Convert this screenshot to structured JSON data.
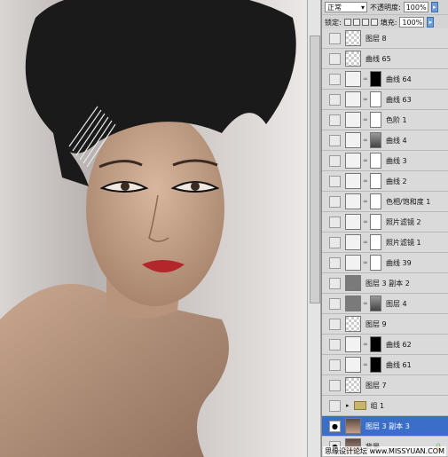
{
  "panel": {
    "blend_mode": "正常",
    "opacity_label": "不透明度:",
    "opacity_value": "100%",
    "lock_label": "锁定:",
    "fill_label": "填充:",
    "fill_value": "100%"
  },
  "layers": [
    {
      "name": "图层 8",
      "thumb": "trans",
      "mask": "none"
    },
    {
      "name": "曲线 65",
      "thumb": "trans",
      "mask": "none"
    },
    {
      "name": "曲线 64",
      "thumb": "adj",
      "mask": "black"
    },
    {
      "name": "曲线 63",
      "thumb": "adj",
      "mask": "white"
    },
    {
      "name": "色阶 1",
      "thumb": "adj",
      "mask": "white"
    },
    {
      "name": "曲线 4",
      "thumb": "adj",
      "mask": "gray"
    },
    {
      "name": "曲线 3",
      "thumb": "adj",
      "mask": "white"
    },
    {
      "name": "曲线 2",
      "thumb": "adj",
      "mask": "white"
    },
    {
      "name": "色相/饱和度 1",
      "thumb": "adj",
      "mask": "white"
    },
    {
      "name": "照片滤镜 2",
      "thumb": "adj",
      "mask": "white"
    },
    {
      "name": "照片滤镜 1",
      "thumb": "adj",
      "mask": "white"
    },
    {
      "name": "曲线 39",
      "thumb": "adj",
      "mask": "white"
    },
    {
      "name": "图层 3 副本 2",
      "thumb": "dark",
      "mask": "none"
    },
    {
      "name": "图层 4",
      "thumb": "dark",
      "mask": "gray"
    },
    {
      "name": "图层 9",
      "thumb": "trans",
      "mask": "none"
    },
    {
      "name": "曲线 62",
      "thumb": "adj",
      "mask": "black"
    },
    {
      "name": "曲线 61",
      "thumb": "adj",
      "mask": "black"
    },
    {
      "name": "图层 7",
      "thumb": "trans",
      "mask": "none"
    },
    {
      "name": "组 1",
      "thumb": "folder",
      "mask": "none"
    },
    {
      "name": "图层 3 副本 3",
      "thumb": "photo",
      "mask": "none",
      "selected": true
    },
    {
      "name": "背景",
      "thumb": "photo",
      "mask": "none"
    }
  ],
  "watermark": "思缘设计论坛 www.MISSYUAN.COM"
}
